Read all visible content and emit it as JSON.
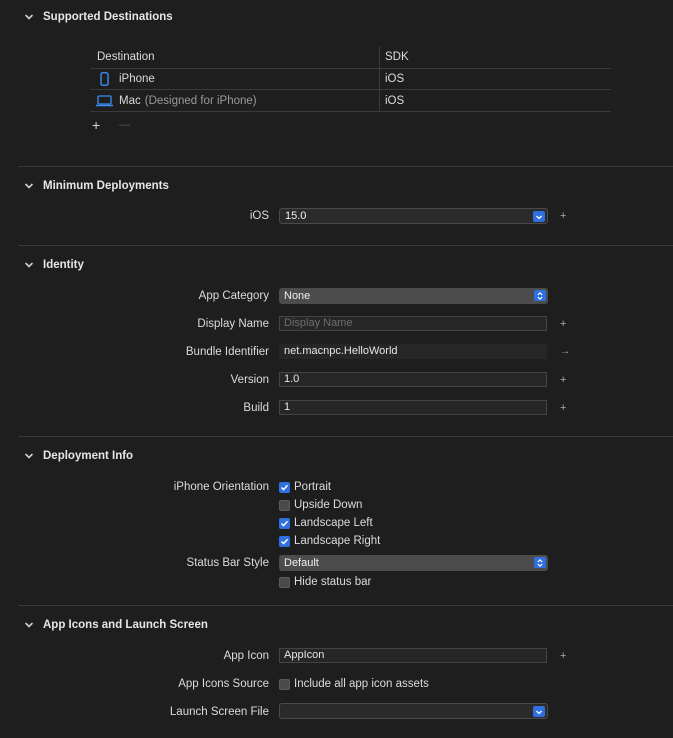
{
  "sections": {
    "supported_destinations": {
      "title": "Supported Destinations",
      "columns": {
        "destination": "Destination",
        "sdk": "SDK"
      },
      "rows": [
        {
          "name": "iPhone",
          "suffix": "",
          "sdk": "iOS",
          "icon": "iphone-icon"
        },
        {
          "name": "Mac",
          "suffix": "(Designed for iPhone)",
          "sdk": "iOS",
          "icon": "laptop-icon"
        }
      ],
      "add": "+",
      "remove": "—"
    },
    "minimum_deployments": {
      "title": "Minimum Deployments",
      "ios_label": "iOS",
      "ios_value": "15.0"
    },
    "identity": {
      "title": "Identity",
      "app_category_label": "App Category",
      "app_category_value": "None",
      "display_name_label": "Display Name",
      "display_name_placeholder": "Display Name",
      "bundle_id_label": "Bundle Identifier",
      "bundle_id_value": "net.macnpc.HelloWorld",
      "version_label": "Version",
      "version_value": "1.0",
      "build_label": "Build",
      "build_value": "1"
    },
    "deployment_info": {
      "title": "Deployment Info",
      "orientation_label": "iPhone Orientation",
      "orientations": [
        {
          "label": "Portrait",
          "checked": true
        },
        {
          "label": "Upside Down",
          "checked": false
        },
        {
          "label": "Landscape Left",
          "checked": true
        },
        {
          "label": "Landscape Right",
          "checked": true
        }
      ],
      "status_bar_label": "Status Bar Style",
      "status_bar_value": "Default",
      "hide_status_bar": "Hide status bar"
    },
    "app_icons": {
      "title": "App Icons and Launch Screen",
      "app_icon_label": "App Icon",
      "app_icon_value": "AppIcon",
      "icons_source_label": "App Icons Source",
      "icons_source_checkbox": "Include all app icon assets",
      "launch_screen_label": "Launch Screen File",
      "launch_screen_value": ""
    }
  },
  "colors": {
    "accent": "#2f6fe0",
    "background": "#1e1e1e",
    "divider": "#3a3a3a"
  }
}
